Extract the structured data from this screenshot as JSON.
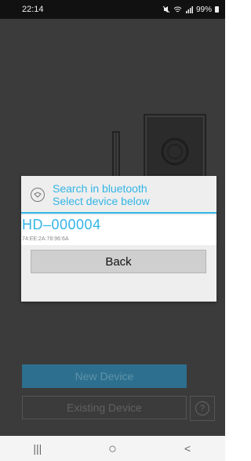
{
  "status_bar": {
    "time": "22:14",
    "battery_percent": "99%",
    "icons": [
      "mute-icon",
      "wifi-icon",
      "signal-icon",
      "battery-icon"
    ]
  },
  "dialog": {
    "title_line1": "Search in bluetooth",
    "title_line2": "Select device below",
    "icon": "bluetooth-search-icon",
    "accent_color": "#33b5e5",
    "devices": [
      {
        "name": "HD–000004",
        "mac": "74:EE:2A:78:96:6A"
      }
    ],
    "back_label": "Back"
  },
  "main": {
    "new_device_label": "New Device",
    "existing_device_label": "Existing Device",
    "help_icon": "question-mark-icon"
  },
  "nav_bar": {
    "recent_glyph": "|||",
    "home_glyph": "○",
    "back_glyph": "<"
  }
}
